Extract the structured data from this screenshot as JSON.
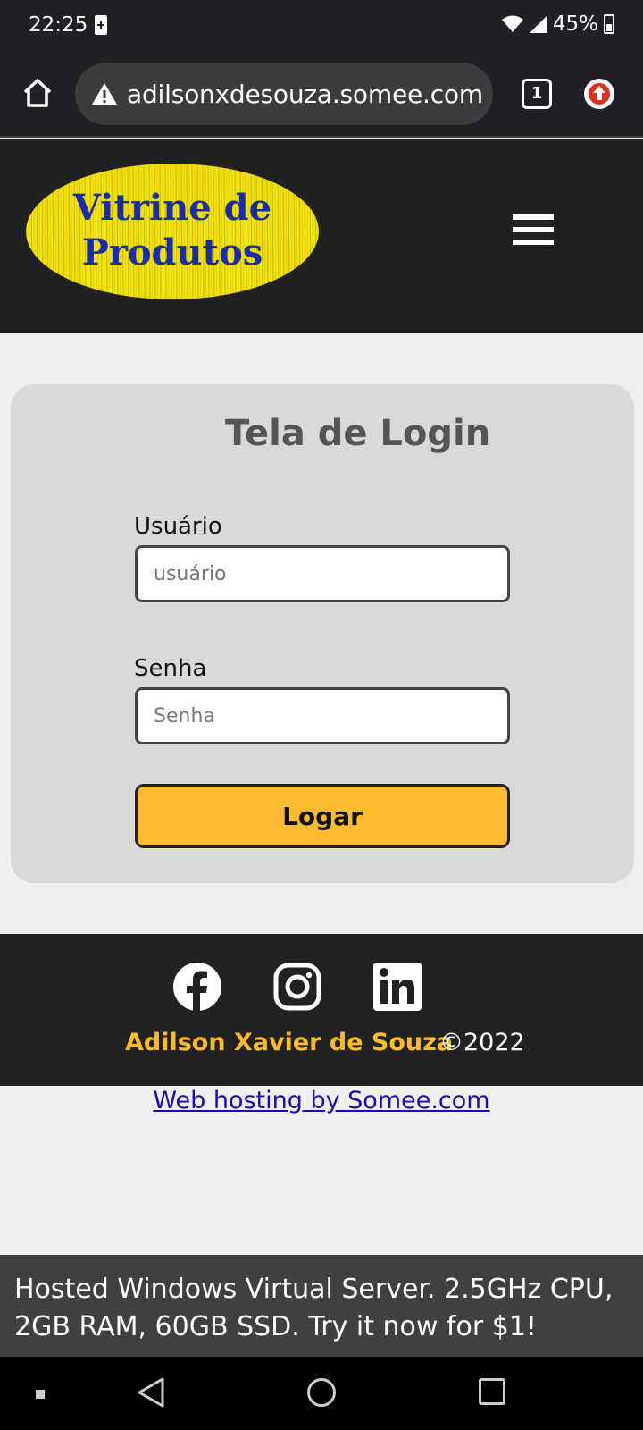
{
  "status_bar": {
    "time": "22:25",
    "battery_percent": "45%"
  },
  "browser": {
    "url": "adilsonxdesouza.somee.com",
    "tab_count": "1"
  },
  "header": {
    "logo_line1": "Vitrine de",
    "logo_line2": "Produtos"
  },
  "login": {
    "title": "Tela de Login",
    "username_label": "Usuário",
    "username_placeholder": "usuário",
    "password_label": "Senha",
    "password_placeholder": "Senha",
    "submit_label": "Logar"
  },
  "footer": {
    "social": [
      "facebook-icon",
      "instagram-icon",
      "linkedin-icon"
    ],
    "author": "Adilson Xavier de Souza",
    "copyright": "©2022"
  },
  "hosting_link": "Web hosting by Somee.com",
  "ad_text": "Hosted Windows Virtual Server. 2.5GHz CPU, 2GB RAM, 60GB SSD. Try it now for $1!",
  "colors": {
    "accent": "#fdbb30",
    "header_bg": "#212121",
    "card_bg": "#d9d9d9",
    "link": "#1a0dab"
  }
}
